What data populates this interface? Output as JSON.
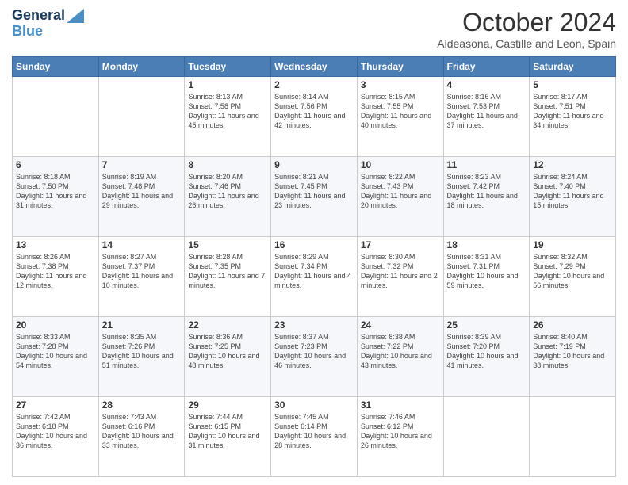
{
  "header": {
    "logo_line1": "General",
    "logo_line2": "Blue",
    "month": "October 2024",
    "location": "Aldeasona, Castille and Leon, Spain"
  },
  "weekdays": [
    "Sunday",
    "Monday",
    "Tuesday",
    "Wednesday",
    "Thursday",
    "Friday",
    "Saturday"
  ],
  "weeks": [
    [
      {
        "day": "",
        "info": ""
      },
      {
        "day": "",
        "info": ""
      },
      {
        "day": "1",
        "info": "Sunrise: 8:13 AM\nSunset: 7:58 PM\nDaylight: 11 hours and 45 minutes."
      },
      {
        "day": "2",
        "info": "Sunrise: 8:14 AM\nSunset: 7:56 PM\nDaylight: 11 hours and 42 minutes."
      },
      {
        "day": "3",
        "info": "Sunrise: 8:15 AM\nSunset: 7:55 PM\nDaylight: 11 hours and 40 minutes."
      },
      {
        "day": "4",
        "info": "Sunrise: 8:16 AM\nSunset: 7:53 PM\nDaylight: 11 hours and 37 minutes."
      },
      {
        "day": "5",
        "info": "Sunrise: 8:17 AM\nSunset: 7:51 PM\nDaylight: 11 hours and 34 minutes."
      }
    ],
    [
      {
        "day": "6",
        "info": "Sunrise: 8:18 AM\nSunset: 7:50 PM\nDaylight: 11 hours and 31 minutes."
      },
      {
        "day": "7",
        "info": "Sunrise: 8:19 AM\nSunset: 7:48 PM\nDaylight: 11 hours and 29 minutes."
      },
      {
        "day": "8",
        "info": "Sunrise: 8:20 AM\nSunset: 7:46 PM\nDaylight: 11 hours and 26 minutes."
      },
      {
        "day": "9",
        "info": "Sunrise: 8:21 AM\nSunset: 7:45 PM\nDaylight: 11 hours and 23 minutes."
      },
      {
        "day": "10",
        "info": "Sunrise: 8:22 AM\nSunset: 7:43 PM\nDaylight: 11 hours and 20 minutes."
      },
      {
        "day": "11",
        "info": "Sunrise: 8:23 AM\nSunset: 7:42 PM\nDaylight: 11 hours and 18 minutes."
      },
      {
        "day": "12",
        "info": "Sunrise: 8:24 AM\nSunset: 7:40 PM\nDaylight: 11 hours and 15 minutes."
      }
    ],
    [
      {
        "day": "13",
        "info": "Sunrise: 8:26 AM\nSunset: 7:38 PM\nDaylight: 11 hours and 12 minutes."
      },
      {
        "day": "14",
        "info": "Sunrise: 8:27 AM\nSunset: 7:37 PM\nDaylight: 11 hours and 10 minutes."
      },
      {
        "day": "15",
        "info": "Sunrise: 8:28 AM\nSunset: 7:35 PM\nDaylight: 11 hours and 7 minutes."
      },
      {
        "day": "16",
        "info": "Sunrise: 8:29 AM\nSunset: 7:34 PM\nDaylight: 11 hours and 4 minutes."
      },
      {
        "day": "17",
        "info": "Sunrise: 8:30 AM\nSunset: 7:32 PM\nDaylight: 11 hours and 2 minutes."
      },
      {
        "day": "18",
        "info": "Sunrise: 8:31 AM\nSunset: 7:31 PM\nDaylight: 10 hours and 59 minutes."
      },
      {
        "day": "19",
        "info": "Sunrise: 8:32 AM\nSunset: 7:29 PM\nDaylight: 10 hours and 56 minutes."
      }
    ],
    [
      {
        "day": "20",
        "info": "Sunrise: 8:33 AM\nSunset: 7:28 PM\nDaylight: 10 hours and 54 minutes."
      },
      {
        "day": "21",
        "info": "Sunrise: 8:35 AM\nSunset: 7:26 PM\nDaylight: 10 hours and 51 minutes."
      },
      {
        "day": "22",
        "info": "Sunrise: 8:36 AM\nSunset: 7:25 PM\nDaylight: 10 hours and 48 minutes."
      },
      {
        "day": "23",
        "info": "Sunrise: 8:37 AM\nSunset: 7:23 PM\nDaylight: 10 hours and 46 minutes."
      },
      {
        "day": "24",
        "info": "Sunrise: 8:38 AM\nSunset: 7:22 PM\nDaylight: 10 hours and 43 minutes."
      },
      {
        "day": "25",
        "info": "Sunrise: 8:39 AM\nSunset: 7:20 PM\nDaylight: 10 hours and 41 minutes."
      },
      {
        "day": "26",
        "info": "Sunrise: 8:40 AM\nSunset: 7:19 PM\nDaylight: 10 hours and 38 minutes."
      }
    ],
    [
      {
        "day": "27",
        "info": "Sunrise: 7:42 AM\nSunset: 6:18 PM\nDaylight: 10 hours and 36 minutes."
      },
      {
        "day": "28",
        "info": "Sunrise: 7:43 AM\nSunset: 6:16 PM\nDaylight: 10 hours and 33 minutes."
      },
      {
        "day": "29",
        "info": "Sunrise: 7:44 AM\nSunset: 6:15 PM\nDaylight: 10 hours and 31 minutes."
      },
      {
        "day": "30",
        "info": "Sunrise: 7:45 AM\nSunset: 6:14 PM\nDaylight: 10 hours and 28 minutes."
      },
      {
        "day": "31",
        "info": "Sunrise: 7:46 AM\nSunset: 6:12 PM\nDaylight: 10 hours and 26 minutes."
      },
      {
        "day": "",
        "info": ""
      },
      {
        "day": "",
        "info": ""
      }
    ]
  ]
}
